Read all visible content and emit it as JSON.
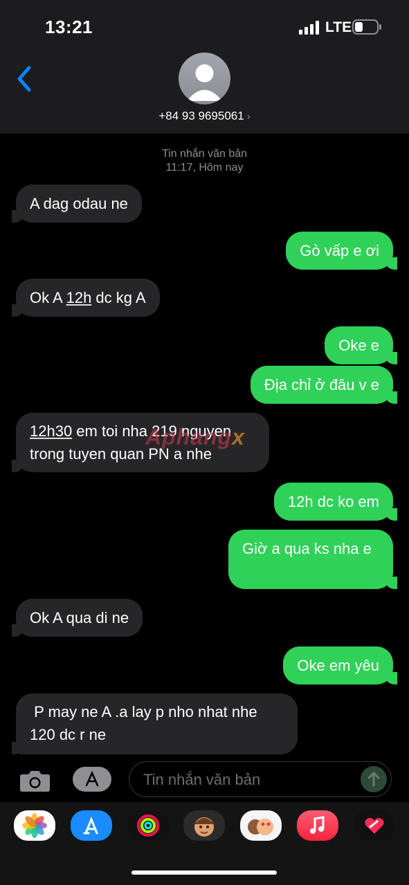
{
  "status": {
    "time": "13:21",
    "network": "LTE"
  },
  "header": {
    "contact": "+84 93 9695061",
    "back_label": "<"
  },
  "thread": {
    "meta_line1": "Tin nhắn văn bản",
    "meta_line2": "11:17, Hôm nay",
    "watermark": "Aphang",
    "watermark_x": "x",
    "messages": [
      {
        "dir": "in",
        "text": "A dag odau ne"
      },
      {
        "dir": "out",
        "text": "Gò vấp e ơi"
      },
      {
        "dir": "in",
        "text_a": "Ok A ",
        "text_link": "12h",
        "text_b": " dc kg A"
      },
      {
        "dir": "out",
        "text": "Oke e"
      },
      {
        "dir": "out",
        "text": "Địa chỉ ở đâu v e"
      },
      {
        "dir": "in",
        "text_link": "12h30",
        "text_a": " em toi nha 219 nguyen",
        "text_b": "trong tuyen quan PN a nhe"
      },
      {
        "dir": "out",
        "text": "12h dc ko em"
      },
      {
        "dir": "out",
        "text": "Giờ a qua ks nha e"
      },
      {
        "dir": "in",
        "text": "Ok A qua di ne"
      },
      {
        "dir": "out",
        "text": "Oke em yêu"
      },
      {
        "dir": "in",
        "line1": " P may ne A .a lay p nho nhat nhe",
        "line2": "120 dc r ne"
      }
    ]
  },
  "composer": {
    "placeholder": "Tin nhắn văn bản"
  },
  "dock": {
    "apps": [
      "photos-icon",
      "app-store-icon",
      "fitness-icon",
      "memoji-icon",
      "memoji-stickers-icon",
      "music-icon",
      "digital-touch-icon"
    ]
  },
  "colors": {
    "outgoing": "#30d158",
    "incoming": "#262628",
    "accent": "#0a84ff"
  }
}
